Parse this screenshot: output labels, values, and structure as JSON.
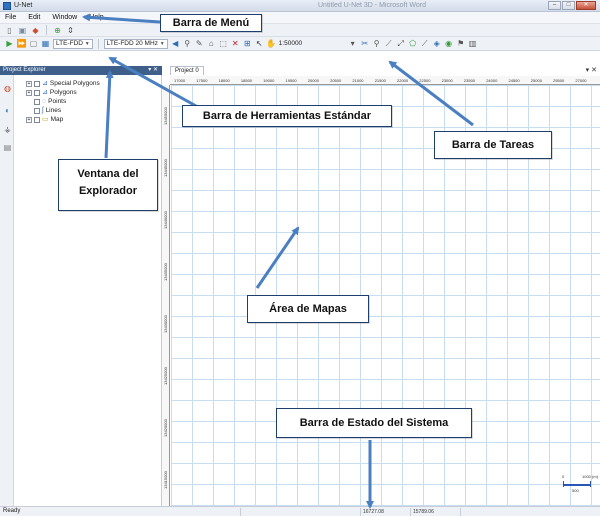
{
  "window": {
    "app_title": "U-Net",
    "doc_title": "Untitled U-Net 3D - Microsoft Word",
    "minimize": "–",
    "maximize": "□",
    "close": "✕"
  },
  "menu": {
    "items": [
      "File",
      "Edit",
      "Window",
      "Help"
    ]
  },
  "toolbar1": {
    "icons": [
      "new-icon",
      "open-icon",
      "save-icon",
      "settings-icon",
      "arrow-icon"
    ]
  },
  "toolbar2": {
    "network_combo": "LTE-FDD",
    "band_combo": "LTE-FDD 20 MHz",
    "zoom_value": "1:50000"
  },
  "explorer": {
    "title": "Project Explorer",
    "pin": "▾ ✕",
    "tree": [
      {
        "label": "Special Polygons",
        "expander": "+"
      },
      {
        "label": "Polygons",
        "expander": "+"
      },
      {
        "label": "Points",
        "expander": ""
      },
      {
        "label": "Lines",
        "expander": ""
      },
      {
        "label": "Map",
        "expander": "+"
      }
    ]
  },
  "map": {
    "tab_label": "Project 0",
    "close_glyph": "▾ ✕",
    "ruler_top": [
      "17000",
      "17500",
      "18000",
      "18500",
      "19000",
      "19500",
      "20000",
      "20500",
      "21000",
      "21500",
      "22000",
      "22500",
      "23000",
      "23500",
      "24000",
      "24500",
      "25000",
      "25500",
      "27000"
    ],
    "ruler_left": [
      "13450000",
      "13445000",
      "13440000",
      "13435000",
      "13430000",
      "13425000",
      "13420000",
      "13415000"
    ],
    "scale_zero": "0",
    "scale_max": "1000 (m)",
    "scale_sub": "500"
  },
  "status": {
    "ready": "Ready",
    "coord_x": "16727.08",
    "coord_y": "15789.06"
  },
  "annotations": {
    "menu_bar": "Barra de Menú",
    "standard_toolbar": "Barra de Herramientas Estándar",
    "task_bar": "Barra de Tareas",
    "explorer_window": "Ventana del Explorador",
    "map_area": "Área de Mapas",
    "status_bar": "Barra de Estado del Sistema"
  },
  "colors": {
    "callout_border": "#1d3f6e",
    "arrow": "#4a7fc1",
    "grid": "#c9ddf0"
  }
}
